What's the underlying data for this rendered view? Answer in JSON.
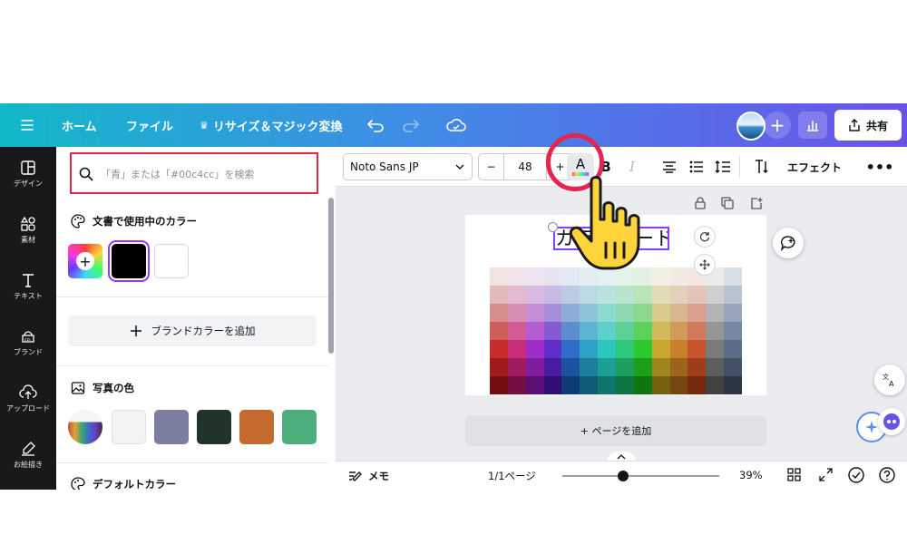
{
  "topbar": {
    "menu_icon": "hamburger-icon",
    "home_label": "ホーム",
    "file_label": "ファイル",
    "resize_label": "リサイズ＆マジック変換",
    "share_label": "共有"
  },
  "rail": {
    "items": [
      {
        "label": "デザイン",
        "icon": "layout-icon"
      },
      {
        "label": "素材",
        "icon": "shapes-icon"
      },
      {
        "label": "テキスト",
        "icon": "text-icon"
      },
      {
        "label": "ブランド",
        "icon": "brand-icon"
      },
      {
        "label": "アップロード",
        "icon": "upload-icon"
      },
      {
        "label": "お絵描き",
        "icon": "draw-icon"
      }
    ]
  },
  "panel": {
    "search_placeholder": "「青」または「#00c4cc」を検索",
    "document_colors_title": "文書で使用中のカラー",
    "document_colors": [
      "rainbow",
      "#000000",
      "#ffffff"
    ],
    "brand_add_label": "ブランドカラーを追加",
    "photo_colors_title": "写真の色",
    "photo_colors": [
      "#f2f3f5",
      "#7c7fa1",
      "#203429",
      "#c56b2f",
      "#4dae7c"
    ],
    "default_colors_title": "デフォルトカラー"
  },
  "toolbar": {
    "font_name": "Noto Sans JP",
    "minus": "−",
    "font_size": "48",
    "plus": "+",
    "effect_label": "エフェクト"
  },
  "canvas": {
    "title_text": "カラーコード",
    "add_page_label": "+ ページを追加"
  },
  "footer": {
    "memo_label": "メモ",
    "page_indicator": "1/1ページ",
    "zoom": "39%",
    "zoom_level": 0.39
  },
  "colors": {
    "accent_purple": "#8b3dff",
    "highlight_red": "#e2264d"
  }
}
